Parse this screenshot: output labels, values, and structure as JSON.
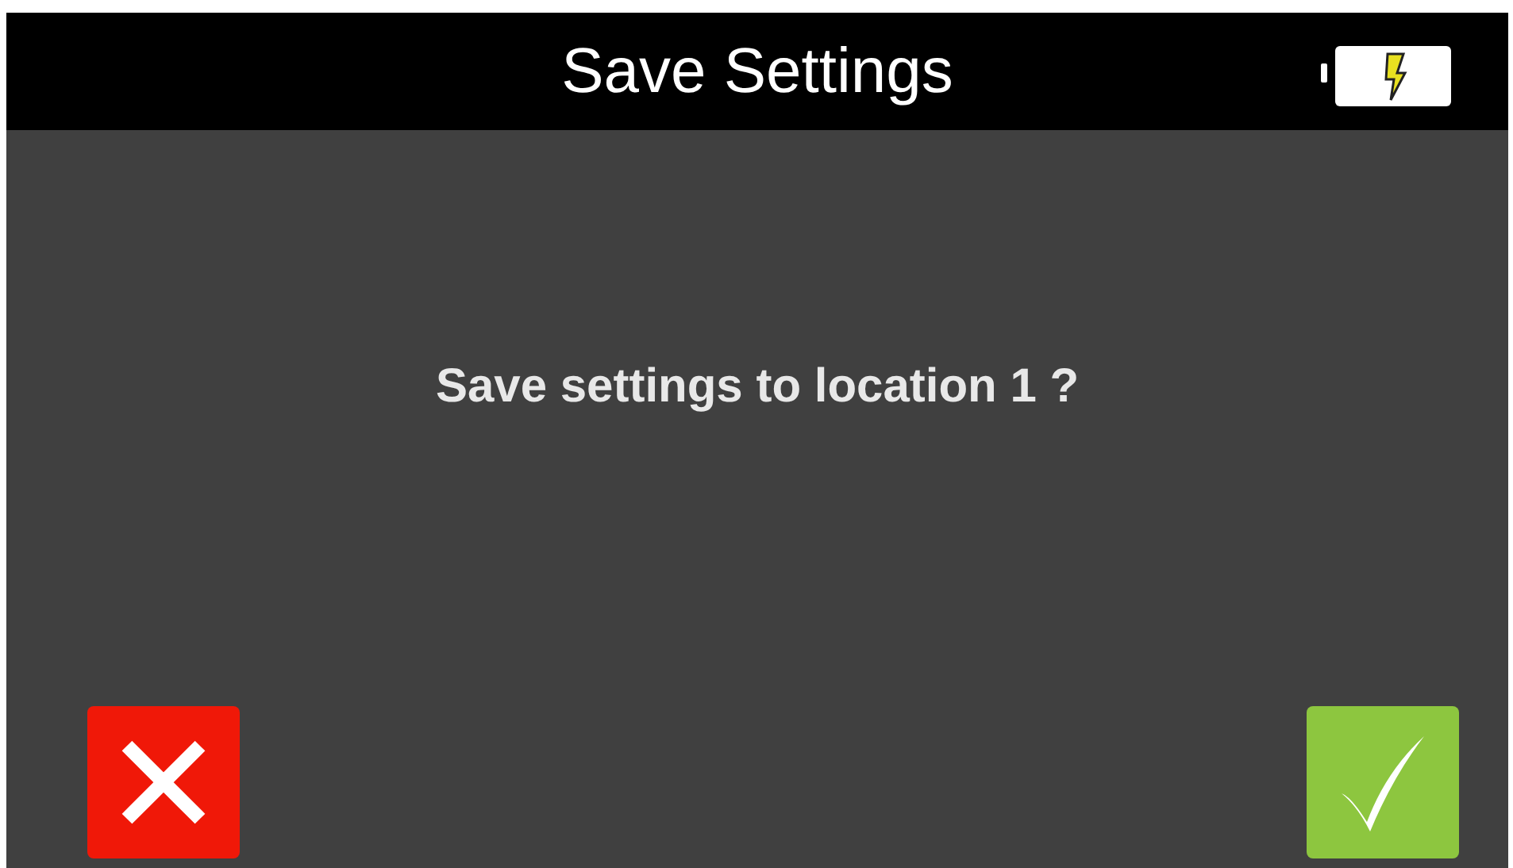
{
  "header": {
    "title": "Save Settings"
  },
  "message": "Save settings to location 1 ?",
  "buttons": [
    {
      "kind": "cancel"
    },
    {
      "kind": "confirm"
    }
  ]
}
